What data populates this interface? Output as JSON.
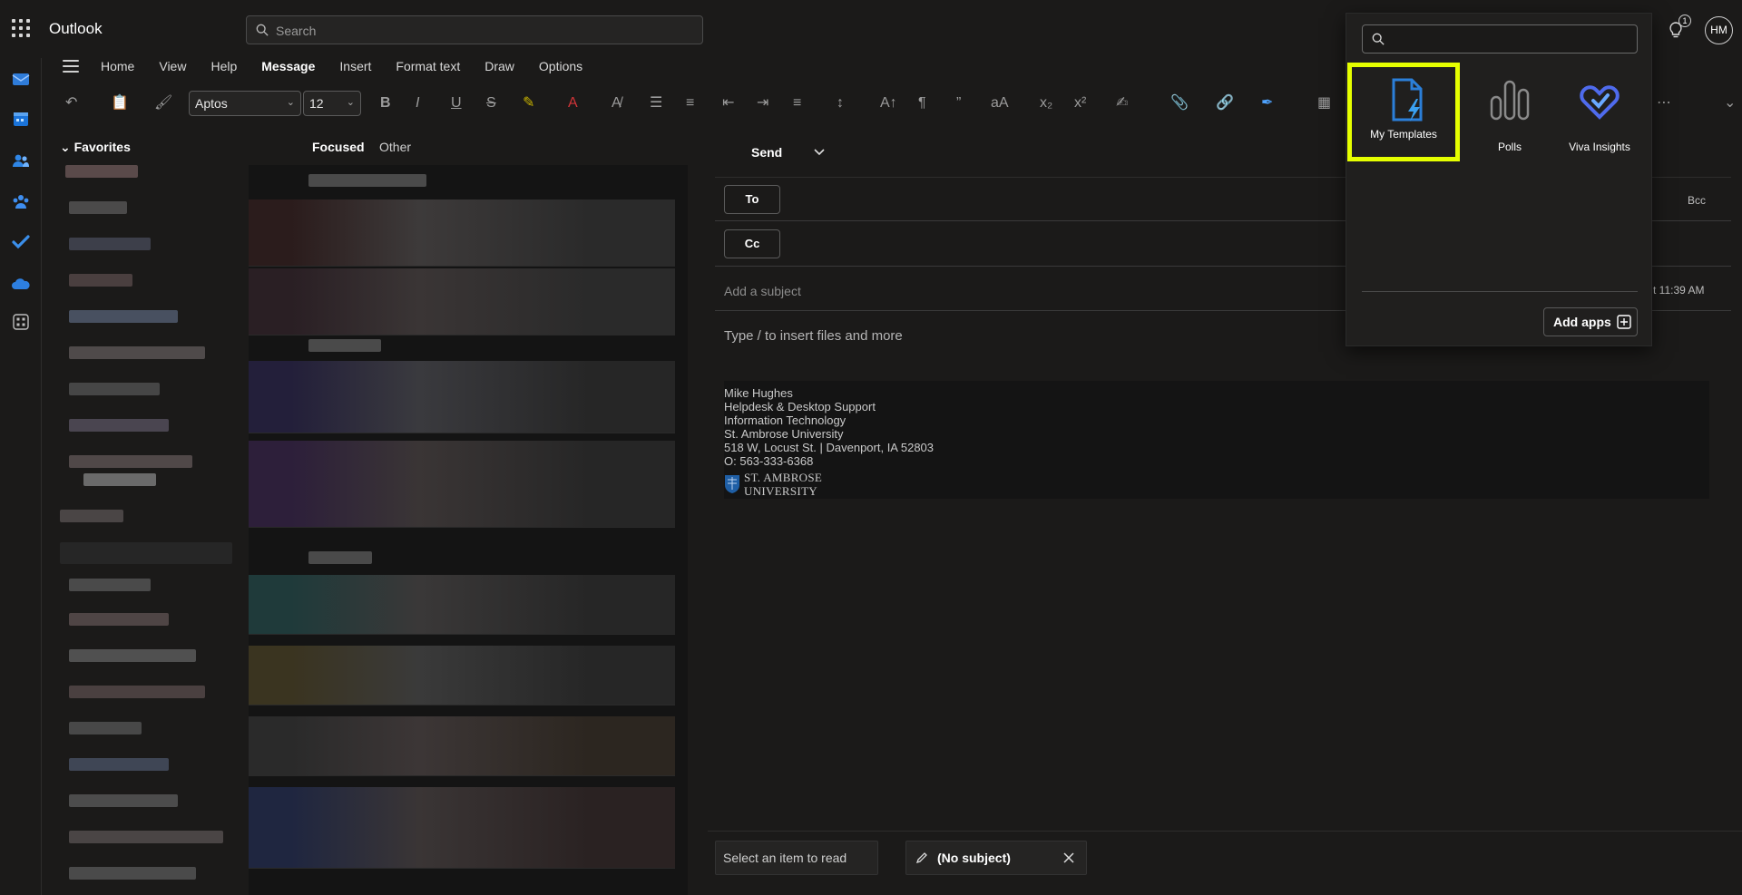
{
  "app": {
    "name": "Outlook"
  },
  "search": {
    "placeholder": "Search"
  },
  "header": {
    "tips_badge": "1",
    "avatar_initials": "HM"
  },
  "ribbon": {
    "tabs": [
      {
        "label": "Home"
      },
      {
        "label": "View"
      },
      {
        "label": "Help"
      },
      {
        "label": "Message"
      },
      {
        "label": "Insert"
      },
      {
        "label": "Format text"
      },
      {
        "label": "Draw"
      },
      {
        "label": "Options"
      }
    ],
    "active_tab": "Message",
    "font_name": "Aptos",
    "font_size": "12"
  },
  "folders": {
    "favorites_label": "Favorites"
  },
  "message_list": {
    "tab_focused": "Focused",
    "tab_other": "Other"
  },
  "compose": {
    "send_label": "Send",
    "to_label": "To",
    "cc_label": "Cc",
    "bcc_label": "Bcc",
    "subject_placeholder": "Add a subject",
    "time_fragment": "t 11:39 AM",
    "body_placeholder": "Type / to insert files and more",
    "signature": [
      "Mike Hughes",
      "Helpdesk & Desktop Support",
      "Information Technology",
      "St. Ambrose University",
      "518 W, Locust St. | Davenport, IA 52803",
      "O: 563-333-6368"
    ],
    "signature_logo_text": [
      "ST. AMBROSE",
      "UNIVERSITY"
    ]
  },
  "bottom_tabs": {
    "reading": "Select an item to read",
    "draft": "(No subject)"
  },
  "apps_flyout": {
    "search_placeholder": "",
    "apps": [
      {
        "label": "My Templates",
        "icon": "templates-icon",
        "highlighted": true
      },
      {
        "label": "Polls",
        "icon": "polls-icon"
      },
      {
        "label": "Viva Insights",
        "icon": "viva-insights-icon"
      }
    ],
    "add_apps_label": "Add apps"
  },
  "colors": {
    "background": "#1b1a19",
    "highlight": "#e5ff00",
    "brand_blue": "#0f6cbd",
    "viva_blue": "#4f6bed"
  }
}
